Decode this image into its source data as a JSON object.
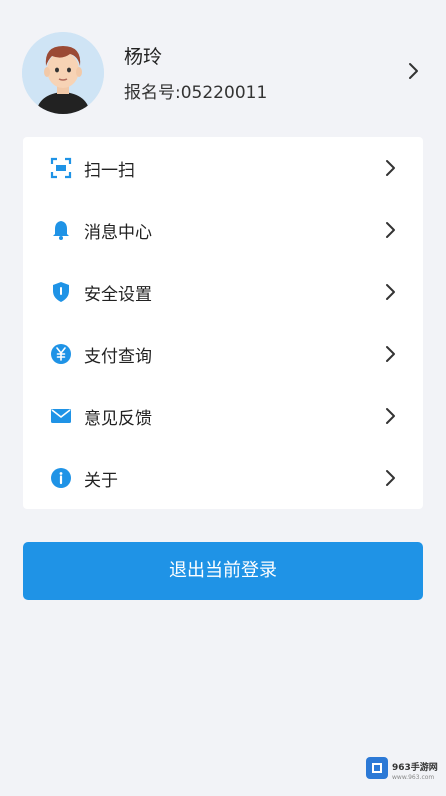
{
  "profile": {
    "name": "杨玲",
    "reg_label": "报名号:",
    "reg_value": "05220011"
  },
  "menu": {
    "items": [
      {
        "label": "扫一扫",
        "icon": "scan-icon"
      },
      {
        "label": "消息中心",
        "icon": "bell-icon"
      },
      {
        "label": "安全设置",
        "icon": "shield-icon"
      },
      {
        "label": "支付查询",
        "icon": "yuan-coin-icon"
      },
      {
        "label": "意见反馈",
        "icon": "mail-icon"
      },
      {
        "label": "关于",
        "icon": "info-icon"
      }
    ]
  },
  "logout": {
    "label": "退出当前登录"
  },
  "watermark": {
    "text": "963手游网",
    "url": "www.963.com"
  },
  "colors": {
    "accent": "#1f93e6",
    "background": "#f2f3f7",
    "icon": "#1f93e6"
  }
}
